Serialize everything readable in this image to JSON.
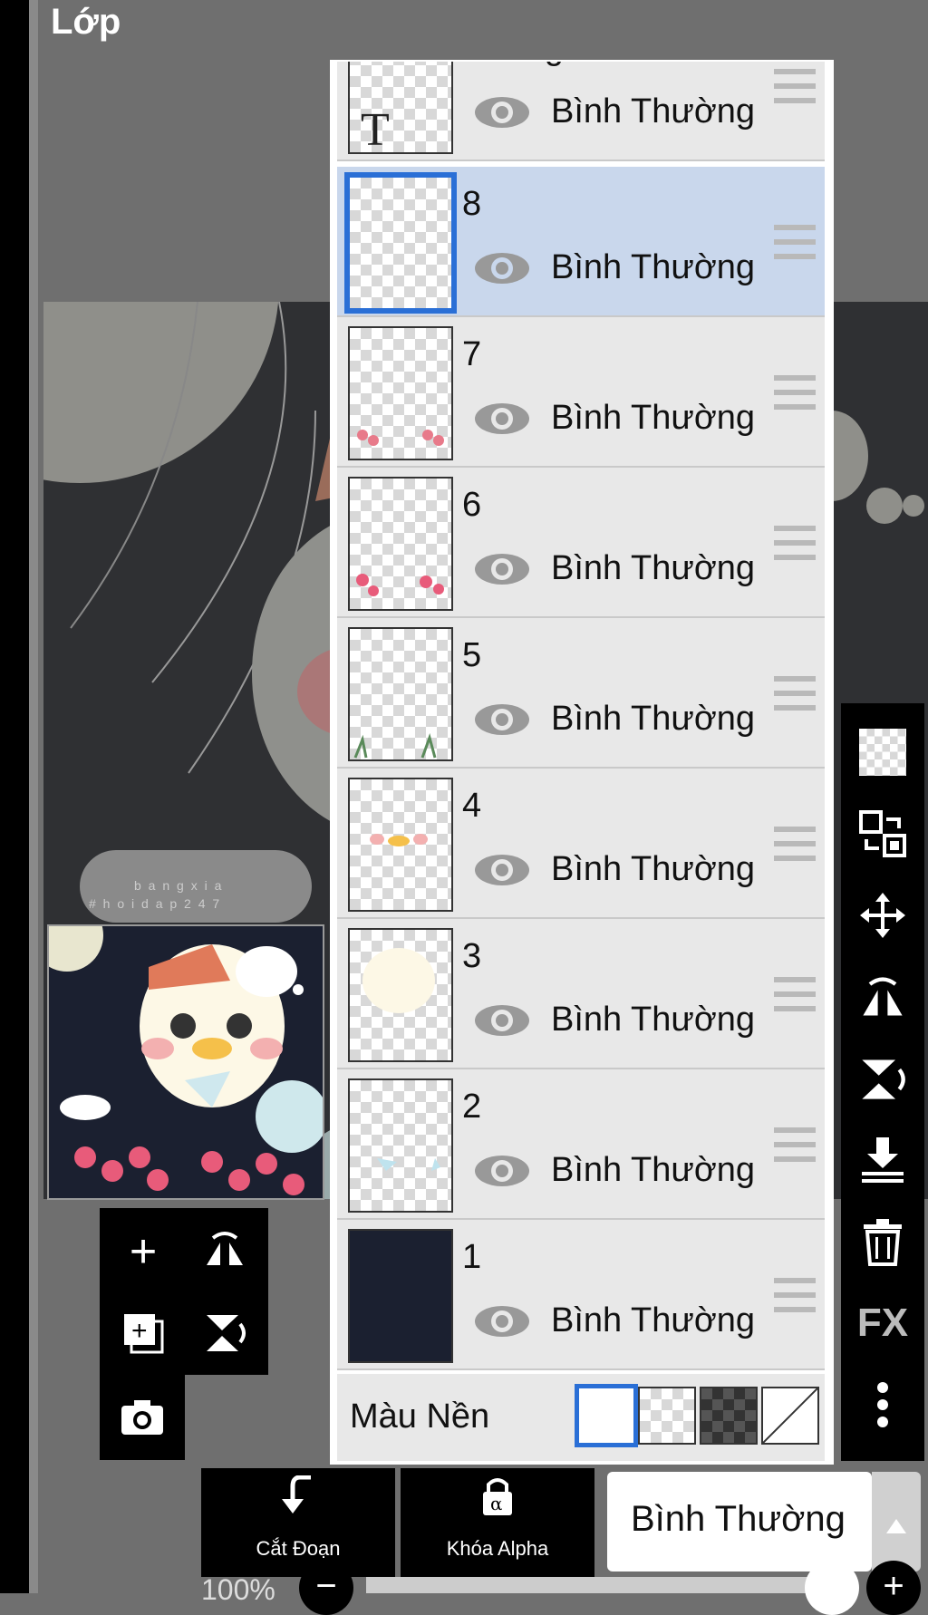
{
  "title": "Lớp",
  "layers": [
    {
      "name": "Hoang Xia",
      "blend": "Bình Thường",
      "type": "text"
    },
    {
      "name": "8",
      "blend": "Bình Thường",
      "selected": true
    },
    {
      "name": "7",
      "blend": "Bình Thường"
    },
    {
      "name": "6",
      "blend": "Bình Thường"
    },
    {
      "name": "5",
      "blend": "Bình Thường"
    },
    {
      "name": "4",
      "blend": "Bình Thường"
    },
    {
      "name": "3",
      "blend": "Bình Thường"
    },
    {
      "name": "2",
      "blend": "Bình Thường"
    },
    {
      "name": "1",
      "blend": "Bình Thường"
    }
  ],
  "text_layer_glyph": "T",
  "background_color_label": "Màu Nền",
  "watermark": {
    "line1": "b a n g x i a",
    "line2": "# h o i d a p 2 4 7"
  },
  "bottom_bar": {
    "cut_label": "Cắt Đoạn",
    "alpha_lock_label": "Khóa Alpha",
    "blend_mode": "Bình Thường",
    "opacity": "100%"
  },
  "right_toolbar": {
    "fx_label": "FX"
  },
  "colors": {
    "selection": "#2a6fd6",
    "selected_row": "#c9d7ec"
  }
}
